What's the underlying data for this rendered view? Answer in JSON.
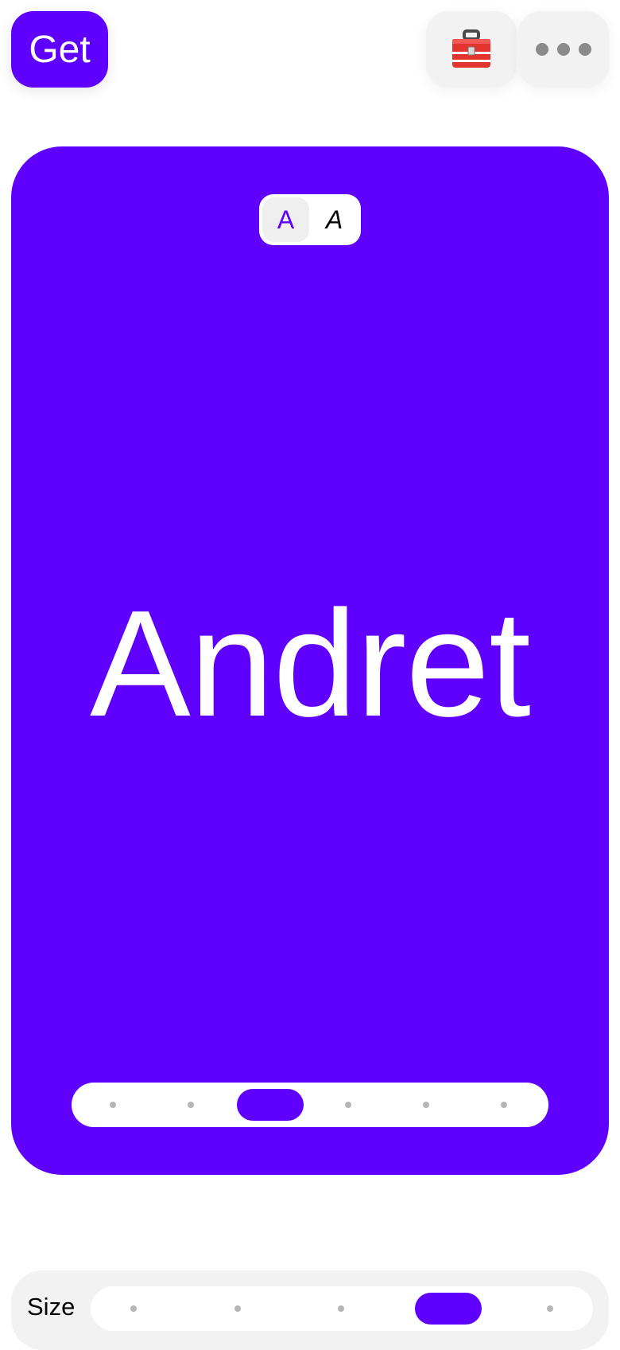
{
  "toolbar": {
    "get_label": "Get",
    "tool_icon": "🧰",
    "more_icon": "more-dots-icon"
  },
  "style_toggle": {
    "options": [
      {
        "label": "A",
        "style": "regular",
        "selected": true
      },
      {
        "label": "A",
        "style": "italic",
        "selected": false
      }
    ]
  },
  "preview": {
    "text": "Andret",
    "background_color": "#5f00ff",
    "text_color": "#ffffff"
  },
  "weight_slider": {
    "stops": 6,
    "selected_index": 2
  },
  "size_control": {
    "label": "Size",
    "stops": 5,
    "selected_index": 3
  },
  "colors": {
    "accent": "#5f00ff",
    "control_background": "#f2f2f2"
  }
}
